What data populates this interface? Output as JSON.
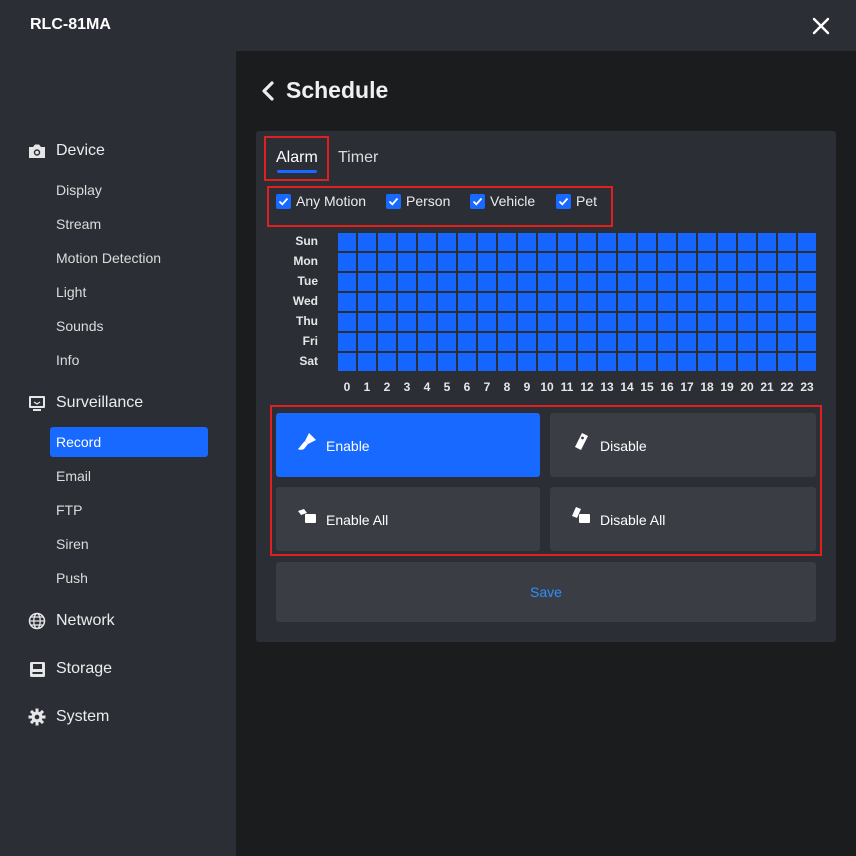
{
  "app": {
    "title": "RLC-81MA"
  },
  "colors": {
    "accent": "#1769ff",
    "highlight": "#e02020",
    "panel": "#2b2e35",
    "cell_on": "#1466ff"
  },
  "sidebar": {
    "groups": {
      "device": {
        "label": "Device",
        "icon": "camera-icon"
      },
      "surveillance": {
        "label": "Surveillance",
        "icon": "monitor-icon"
      },
      "network": {
        "label": "Network",
        "icon": "globe-icon"
      },
      "storage": {
        "label": "Storage",
        "icon": "disk-icon"
      },
      "system": {
        "label": "System",
        "icon": "gear-icon"
      }
    },
    "device_items": [
      "Display",
      "Stream",
      "Motion Detection",
      "Light",
      "Sounds",
      "Info"
    ],
    "surveillance_items": [
      "Record",
      "Email",
      "FTP",
      "Siren",
      "Push"
    ],
    "active_item": "Record"
  },
  "page": {
    "title": "Schedule"
  },
  "tabs": {
    "alarm": "Alarm",
    "timer": "Timer",
    "active": "Alarm"
  },
  "filters": [
    {
      "label": "Any Motion",
      "checked": true
    },
    {
      "label": "Person",
      "checked": true
    },
    {
      "label": "Vehicle",
      "checked": true
    },
    {
      "label": "Pet",
      "checked": true
    }
  ],
  "schedule": {
    "days": [
      "Sun",
      "Mon",
      "Tue",
      "Wed",
      "Thu",
      "Fri",
      "Sat"
    ],
    "hours": [
      "0",
      "1",
      "2",
      "3",
      "4",
      "5",
      "6",
      "7",
      "8",
      "9",
      "10",
      "11",
      "12",
      "13",
      "14",
      "15",
      "16",
      "17",
      "18",
      "19",
      "20",
      "21",
      "22",
      "23"
    ],
    "all_enabled": true
  },
  "actions": {
    "enable": "Enable",
    "disable": "Disable",
    "enable_all": "Enable All",
    "disable_all": "Disable All",
    "selected": "Enable"
  },
  "save_label": "Save"
}
